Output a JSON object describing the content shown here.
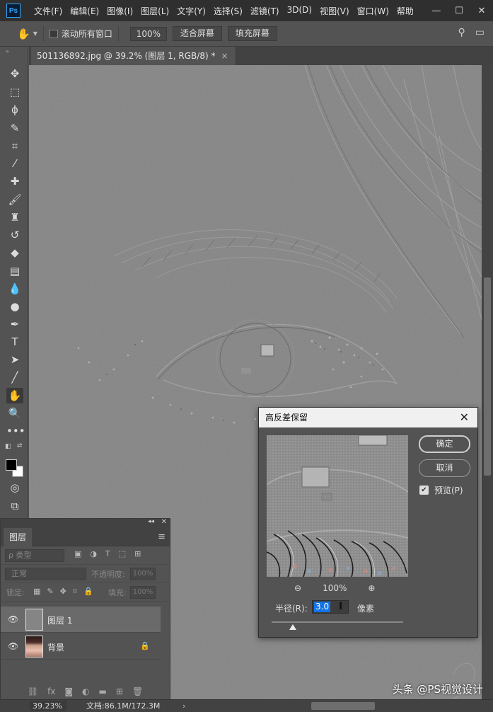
{
  "menubar": {
    "logo": "Ps",
    "items": [
      "文件(F)",
      "编辑(E)",
      "图像(I)",
      "图层(L)",
      "文字(Y)",
      "选择(S)",
      "滤镜(T)",
      "3D(D)",
      "视图(V)",
      "窗口(W)",
      "帮助"
    ],
    "window_controls": [
      "—",
      "☐",
      "✕"
    ]
  },
  "options": {
    "scroll_all_label": "滚动所有窗口",
    "zoom_value": "100%",
    "fit_screen": "适合屏幕",
    "fill_screen": "填充屏幕"
  },
  "document": {
    "tab_title": "501136892.jpg @ 39.2% (图层 1, RGB/8) *",
    "close": "×"
  },
  "status": {
    "zoom": "39.23%",
    "doc_info": "文档:86.1M/172.3M",
    "arrow": "›"
  },
  "layers_panel": {
    "tab": "图层",
    "search_placeholder": "ρ 类型",
    "blend_mode": "正常",
    "opacity_label": "不透明度:",
    "opacity_value": "100%",
    "lock_label": "锁定:",
    "fill_label": "填充:",
    "fill_value": "100%",
    "layers": [
      {
        "name": "图层 1",
        "selected": true
      },
      {
        "name": "背景",
        "selected": false,
        "locked": true
      }
    ],
    "bottom_icons": [
      "link-icon",
      "fx-icon",
      "mask-icon",
      "adjustment-icon",
      "folder-icon",
      "new-layer-icon",
      "trash-icon"
    ]
  },
  "dialog": {
    "title": "高反差保留",
    "ok": "确定",
    "cancel": "取消",
    "preview_label": "预览(P)",
    "preview_checked": true,
    "zoom_level": "100%",
    "radius_label": "半径(R):",
    "radius_value": "3.0",
    "unit": "像素",
    "slider_fraction": 0.16
  },
  "watermark": "头条 @PS视觉设计",
  "colors": {
    "accent": "#1473e6",
    "foreground": "#000000",
    "background": "#ffffff"
  }
}
